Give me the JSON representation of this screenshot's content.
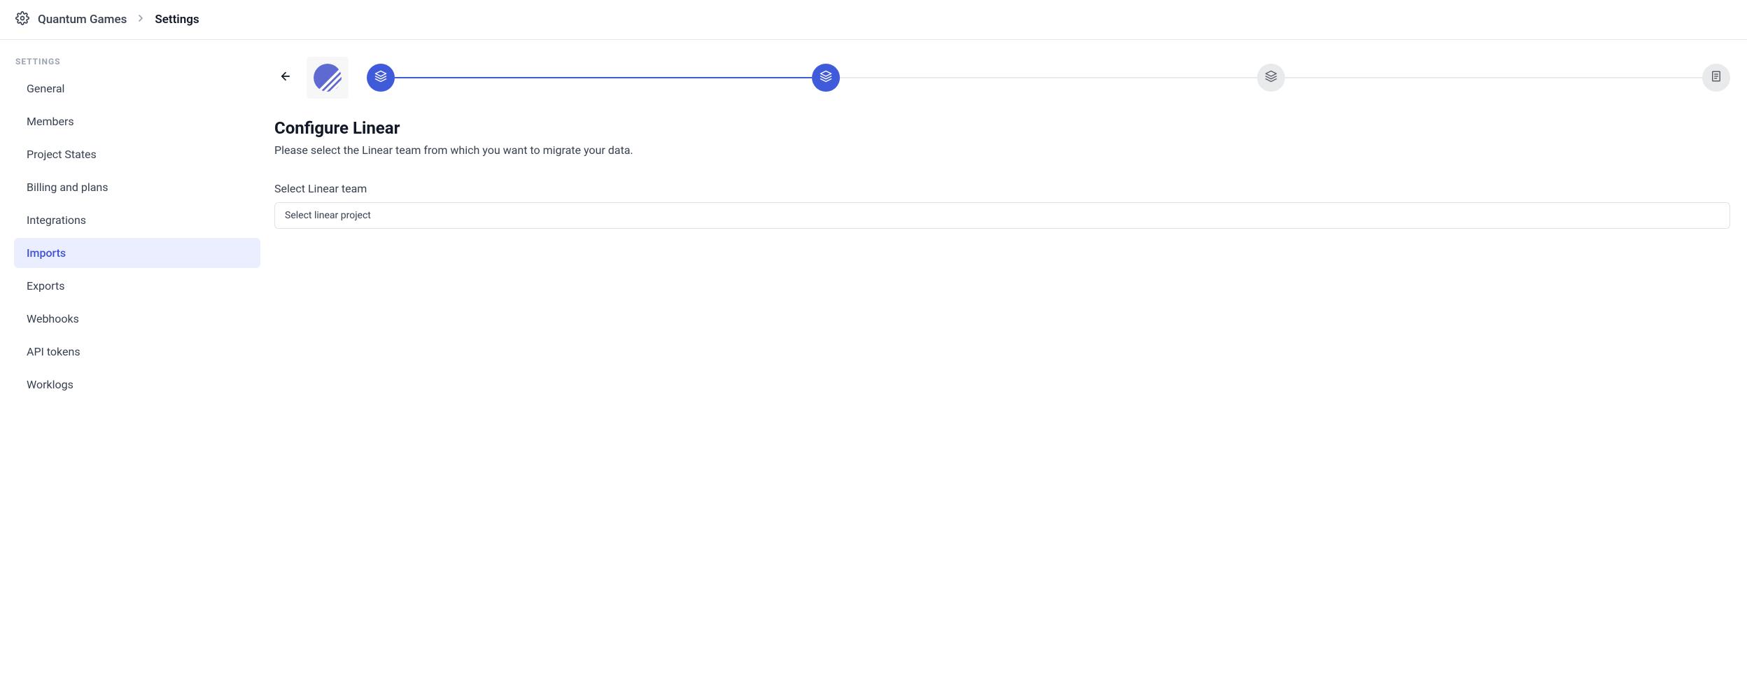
{
  "breadcrumb": {
    "org": "Quantum Games",
    "page": "Settings"
  },
  "sidebar": {
    "heading": "SETTINGS",
    "items": [
      {
        "label": "General",
        "active": false
      },
      {
        "label": "Members",
        "active": false
      },
      {
        "label": "Project States",
        "active": false
      },
      {
        "label": "Billing and plans",
        "active": false
      },
      {
        "label": "Integrations",
        "active": false
      },
      {
        "label": "Imports",
        "active": true
      },
      {
        "label": "Exports",
        "active": false
      },
      {
        "label": "Webhooks",
        "active": false
      },
      {
        "label": "API tokens",
        "active": false
      },
      {
        "label": "Worklogs",
        "active": false
      }
    ]
  },
  "main": {
    "title": "Configure Linear",
    "subtitle": "Please select the Linear team from which you want to migrate your data.",
    "field_label": "Select Linear team",
    "select_placeholder": "Select linear project"
  },
  "stepper": {
    "steps": [
      {
        "state": "done",
        "icon": "layers"
      },
      {
        "state": "active",
        "icon": "layers"
      },
      {
        "state": "pending",
        "icon": "layers"
      },
      {
        "state": "pending",
        "icon": "document"
      }
    ]
  },
  "colors": {
    "accent": "#3f5bd9",
    "sidebar_active_bg": "#eaeefe",
    "sidebar_active_fg": "#3f51d6"
  }
}
